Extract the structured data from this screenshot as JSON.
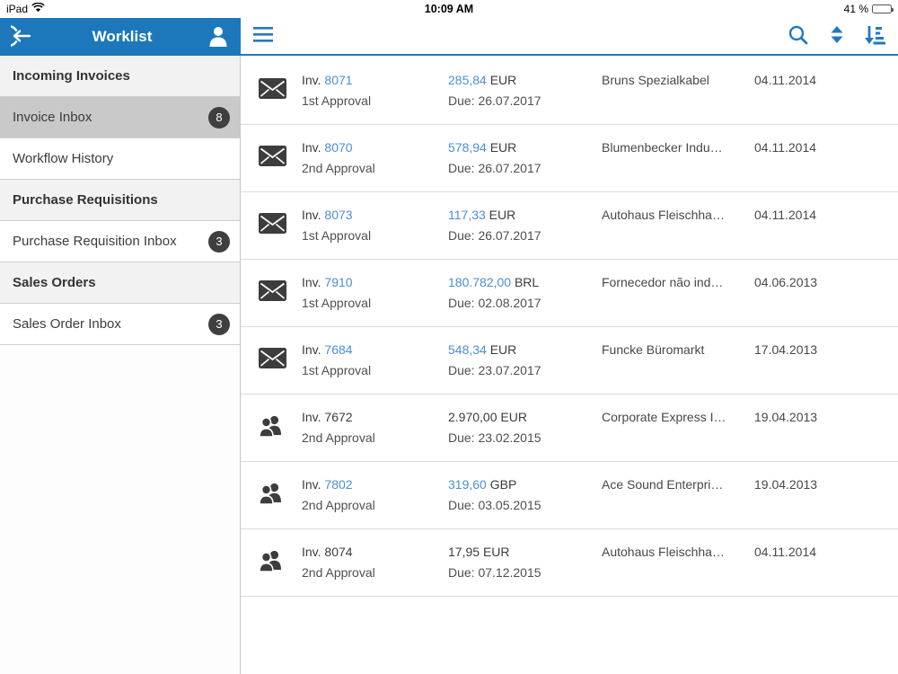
{
  "status_bar": {
    "carrier": "iPad",
    "time": "10:09 AM",
    "battery": "41 %"
  },
  "sidebar": {
    "title": "Worklist",
    "items": [
      {
        "label": "Incoming Invoices",
        "type": "header"
      },
      {
        "label": "Invoice Inbox",
        "type": "item",
        "badge": "8",
        "selected": true
      },
      {
        "label": "Workflow History",
        "type": "item"
      },
      {
        "label": "Purchase Requisitions",
        "type": "header"
      },
      {
        "label": "Purchase Requisition Inbox",
        "type": "item",
        "badge": "3"
      },
      {
        "label": "Sales Orders",
        "type": "header"
      },
      {
        "label": "Sales Order Inbox",
        "type": "item",
        "badge": "3"
      }
    ]
  },
  "list": {
    "inv_prefix": "Inv.",
    "due_prefix": "Due:",
    "rows": [
      {
        "icon": "envelope",
        "number": "8071",
        "number_linked": true,
        "stage": "1st Approval",
        "amount": "285,84",
        "currency": "EUR",
        "amount_linked": true,
        "due_date": "26.07.2017",
        "vendor": "Bruns Spezialkabel",
        "date": "04.11.2014"
      },
      {
        "icon": "envelope",
        "number": "8070",
        "number_linked": true,
        "stage": "2nd Approval",
        "amount": "578,94",
        "currency": "EUR",
        "amount_linked": true,
        "due_date": "26.07.2017",
        "vendor": "Blumenbecker Indu…",
        "date": "04.11.2014"
      },
      {
        "icon": "envelope",
        "number": "8073",
        "number_linked": true,
        "stage": "1st Approval",
        "amount": "117,33",
        "currency": "EUR",
        "amount_linked": true,
        "due_date": "26.07.2017",
        "vendor": "Autohaus Fleischha…",
        "date": "04.11.2014"
      },
      {
        "icon": "envelope",
        "number": "7910",
        "number_linked": true,
        "stage": "1st Approval",
        "amount": "180.782,00",
        "currency": "BRL",
        "amount_linked": true,
        "due_date": "02.08.2017",
        "vendor": "Fornecedor não ind…",
        "date": "04.06.2013"
      },
      {
        "icon": "envelope",
        "number": "7684",
        "number_linked": true,
        "stage": "1st Approval",
        "amount": "548,34",
        "currency": "EUR",
        "amount_linked": true,
        "due_date": "23.07.2017",
        "vendor": "Funcke Büromarkt",
        "date": "17.04.2013"
      },
      {
        "icon": "people",
        "number": "7672",
        "number_linked": false,
        "stage": "2nd Approval",
        "amount": "2.970,00",
        "currency": "EUR",
        "amount_linked": false,
        "due_date": "23.02.2015",
        "vendor": "Corporate Express I…",
        "date": "19.04.2013"
      },
      {
        "icon": "people",
        "number": "7802",
        "number_linked": true,
        "stage": "2nd Approval",
        "amount": "319,60",
        "currency": "GBP",
        "amount_linked": true,
        "due_date": "03.05.2015",
        "vendor": "Ace Sound Enterpri…",
        "date": "19.04.2013"
      },
      {
        "icon": "people",
        "number": "8074",
        "number_linked": false,
        "stage": "2nd Approval",
        "amount": "17,95",
        "currency": "EUR",
        "amount_linked": false,
        "due_date": "07.12.2015",
        "vendor": "Autohaus Fleischha…",
        "date": "04.11.2014"
      }
    ]
  },
  "colors": {
    "header_blue": "#1c78bb",
    "link_blue": "#4a90d2",
    "badge_dark": "#3f3f3f",
    "icon_dark": "#3d3d3d"
  }
}
